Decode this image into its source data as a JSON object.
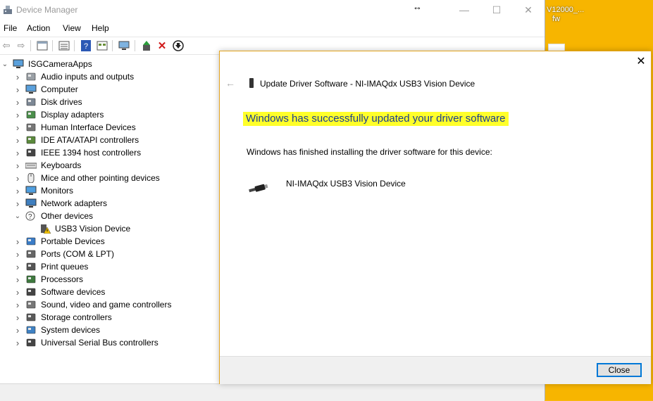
{
  "desktop": {
    "label_line1": "V12000_...",
    "label_line2": "fw"
  },
  "window": {
    "title": "Device Manager"
  },
  "menu": [
    "File",
    "Action",
    "View",
    "Help"
  ],
  "toolbar_icons": [
    "back-arrow-icon",
    "forward-arrow-icon",
    "properties-icon",
    "details-view-icon",
    "help-icon",
    "show-hidden-icon",
    "monitor-scan-icon",
    "update-driver-icon",
    "uninstall-icon",
    "disable-device-icon"
  ],
  "tree": {
    "root": "ISGCameraApps",
    "categories": [
      {
        "label": "Audio inputs and outputs",
        "icon": "speaker-icon",
        "expanded": false
      },
      {
        "label": "Computer",
        "icon": "computer-icon",
        "expanded": false
      },
      {
        "label": "Disk drives",
        "icon": "disk-drive-icon",
        "expanded": false
      },
      {
        "label": "Display adapters",
        "icon": "display-adapter-icon",
        "expanded": false
      },
      {
        "label": "Human Interface Devices",
        "icon": "hid-icon",
        "expanded": false
      },
      {
        "label": "IDE ATA/ATAPI controllers",
        "icon": "ide-controller-icon",
        "expanded": false
      },
      {
        "label": "IEEE 1394 host controllers",
        "icon": "firewire-icon",
        "expanded": false
      },
      {
        "label": "Keyboards",
        "icon": "keyboard-icon",
        "expanded": false
      },
      {
        "label": "Mice and other pointing devices",
        "icon": "mouse-icon",
        "expanded": false
      },
      {
        "label": "Monitors",
        "icon": "monitor-icon",
        "expanded": false
      },
      {
        "label": "Network adapters",
        "icon": "network-adapter-icon",
        "expanded": false
      },
      {
        "label": "Other devices",
        "icon": "unknown-device-icon",
        "expanded": true
      },
      {
        "label": "USB3 Vision Device",
        "icon": "warning-device-icon",
        "child": true
      },
      {
        "label": "Portable Devices",
        "icon": "portable-device-icon",
        "expanded": false
      },
      {
        "label": "Ports (COM & LPT)",
        "icon": "port-icon",
        "expanded": false
      },
      {
        "label": "Print queues",
        "icon": "printer-icon",
        "expanded": false
      },
      {
        "label": "Processors",
        "icon": "processor-icon",
        "expanded": false
      },
      {
        "label": "Software devices",
        "icon": "software-device-icon",
        "expanded": false
      },
      {
        "label": "Sound, video and game controllers",
        "icon": "sound-controller-icon",
        "expanded": false
      },
      {
        "label": "Storage controllers",
        "icon": "storage-controller-icon",
        "expanded": false
      },
      {
        "label": "System devices",
        "icon": "system-device-icon",
        "expanded": false
      },
      {
        "label": "Universal Serial Bus controllers",
        "icon": "usb-controller-icon",
        "expanded": false
      }
    ]
  },
  "dialog": {
    "title": "Update Driver Software - NI-IMAQdx USB3 Vision Device",
    "heading": "Windows has successfully updated your driver software",
    "message": "Windows has finished installing the driver software for this device:",
    "device_name": "NI-IMAQdx USB3 Vision Device",
    "close_label": "Close",
    "heading_highlight": "#ffff2a",
    "heading_color": "#1a3d8f"
  }
}
